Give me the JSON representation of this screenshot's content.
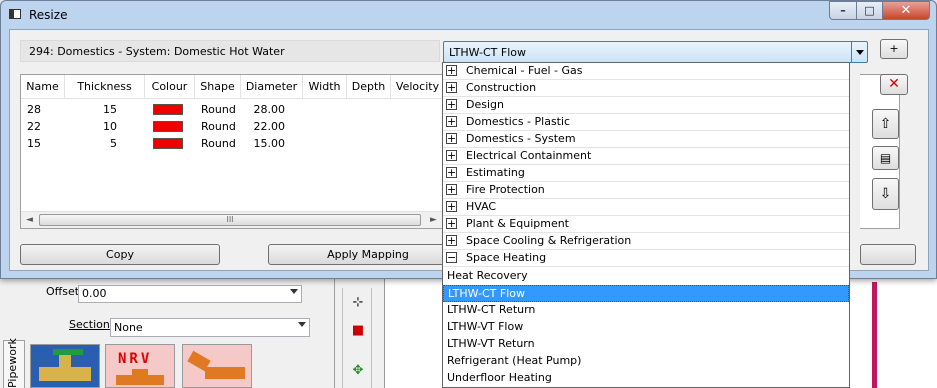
{
  "dialog": {
    "title": "Resize",
    "system_label": "294: Domestics - System: Domestic Hot Water",
    "mapping_selected": "LTHW-CT Flow",
    "buttons": {
      "copy": "Copy",
      "apply": "Apply Mapping"
    },
    "side_buttons": {
      "add": "+"
    }
  },
  "grid": {
    "columns": [
      "Name",
      "Thickness",
      "Colour",
      "Shape",
      "Diameter",
      "Width",
      "Depth",
      "Velocity"
    ],
    "rows": [
      {
        "name": "28",
        "thickness": "15",
        "colour": "#ee0000",
        "shape": "Round",
        "diameter": "28.00"
      },
      {
        "name": "22",
        "thickness": "10",
        "colour": "#ee0000",
        "shape": "Round",
        "diameter": "22.00"
      },
      {
        "name": "15",
        "thickness": "5",
        "colour": "#ee0000",
        "shape": "Round",
        "diameter": "15.00"
      }
    ],
    "scroll_left": "◄",
    "scroll_right": "►",
    "scroll_thumb": "III"
  },
  "dropdown": {
    "groups": [
      "Chemical - Fuel - Gas",
      "Construction",
      "Design",
      "Domestics - Plastic",
      "Domestics - System",
      "Electrical Containment",
      "Estimating",
      "Fire Protection",
      "HVAC",
      "Plant & Equipment",
      "Space Cooling & Refrigeration",
      "Space Heating"
    ],
    "expander_collapsed": "+",
    "expander_expanded": "−",
    "children": [
      "Heat Recovery",
      "LTHW-CT Flow",
      "LTHW-CT Return",
      "LTHW-VT Flow",
      "LTHW-VT Return",
      "Refrigerant (Heat Pump)",
      "Underfloor Heating"
    ],
    "selected": "LTHW-CT Flow"
  },
  "background": {
    "offset_label": "Offset",
    "offset_value": "0.00",
    "section_label": "Section",
    "section_value": "None",
    "tab_label": "Pipework",
    "tile_label": "NRV"
  }
}
